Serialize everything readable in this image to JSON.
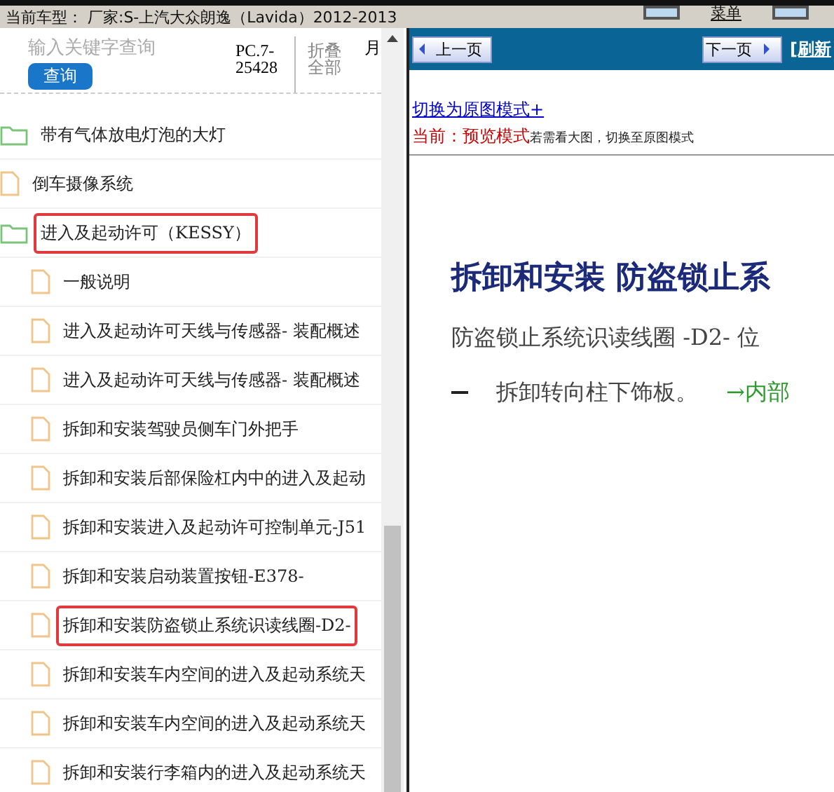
{
  "top_bar": {
    "vehicle": "当前车型：  厂家:S-上汽大众朗逸（Lavida）2012-2013",
    "menu_label": "菜单"
  },
  "search": {
    "placeholder": "输入关键字查询",
    "button": "查询",
    "code": "PC.7-25428",
    "collapse": "折叠全部",
    "tail": "月"
  },
  "tree": [
    {
      "kind": "folder",
      "label": "带有气体放电灯泡的大灯",
      "highlighted": false
    },
    {
      "kind": "file",
      "label": "倒车摄像系统",
      "highlighted": false
    },
    {
      "kind": "folder",
      "label": "进入及起动许可（KESSY）",
      "highlighted": true,
      "children": [
        {
          "kind": "file",
          "label": "一般说明",
          "highlighted": false
        },
        {
          "kind": "file",
          "label": "进入及起动许可天线与传感器- 装配概述",
          "highlighted": false
        },
        {
          "kind": "file",
          "label": "进入及起动许可天线与传感器- 装配概述",
          "highlighted": false
        },
        {
          "kind": "file",
          "label": "拆卸和安装驾驶员侧车门外把手",
          "highlighted": false
        },
        {
          "kind": "file",
          "label": "拆卸和安装后部保险杠内中的进入及起动",
          "highlighted": false
        },
        {
          "kind": "file",
          "label": "拆卸和安装进入及起动许可控制单元-J51",
          "highlighted": false
        },
        {
          "kind": "file",
          "label": "拆卸和安装启动装置按钮-E378-",
          "highlighted": false
        },
        {
          "kind": "file",
          "label": "拆卸和安装防盗锁止系统识读线圈-D2-",
          "highlighted": true
        },
        {
          "kind": "file",
          "label": "拆卸和安装车内空间的进入及起动系统天",
          "highlighted": false
        },
        {
          "kind": "file",
          "label": "拆卸和安装车内空间的进入及起动系统天",
          "highlighted": false
        },
        {
          "kind": "file",
          "label": "拆卸和安装行李箱内的进入及起动系统天",
          "highlighted": false
        }
      ]
    }
  ],
  "viewer": {
    "prev": "上一页",
    "next": "下一页",
    "refresh": "[刷新",
    "switch_link": "切换为原图模式+",
    "mode_label": "当前：预览模式",
    "mode_hint": "若需看大图，切换至原图模式",
    "doc": {
      "heading": "拆卸和安装 防盗锁止系",
      "line": "防盗锁止系统识读线圈 -D2- 位",
      "step": "拆卸转向柱下饰板。",
      "step_link": "→内部"
    }
  }
}
